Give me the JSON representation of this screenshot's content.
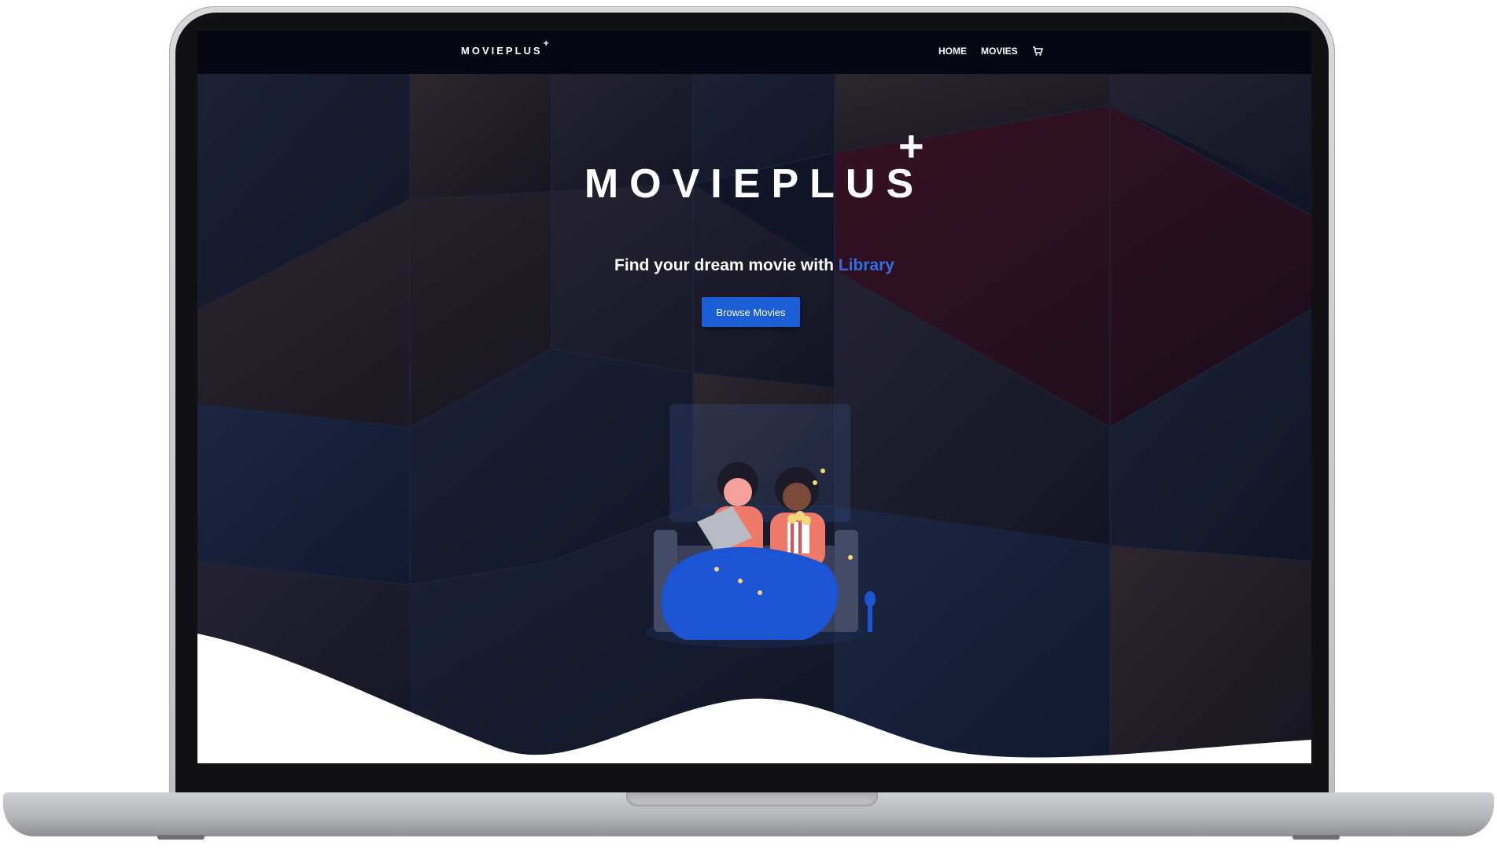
{
  "nav": {
    "logo": "MOVIEPLUS",
    "logo_plus": "+",
    "items": [
      {
        "label": "HOME"
      },
      {
        "label": "MOVIES"
      }
    ],
    "cart_icon": "cart-icon"
  },
  "hero": {
    "title": "MOVIEPLUS",
    "title_plus": "+",
    "subtitle_prefix": "Find your dream movie with ",
    "subtitle_highlight": "Library",
    "button_label": "Browse Movies"
  },
  "colors": {
    "accent": "#1a5fd6",
    "highlight": "#2f6fe6",
    "navbar": "#050813",
    "blanket": "#1b55d3",
    "shirt": "#f07a6a"
  }
}
